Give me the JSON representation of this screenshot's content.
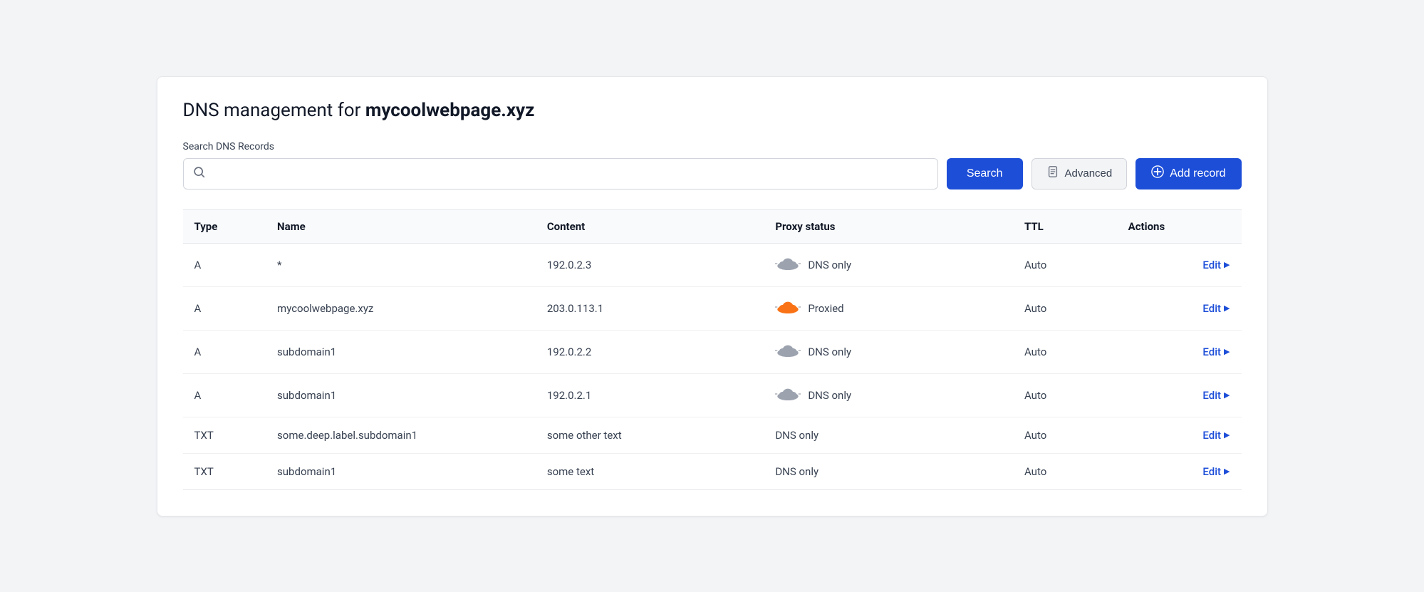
{
  "page": {
    "title_prefix": "DNS management for ",
    "title_domain": "mycoolwebpage.xyz"
  },
  "search": {
    "label": "Search DNS Records",
    "placeholder": "",
    "search_button": "Search",
    "advanced_button": "Advanced",
    "add_record_button": "Add record"
  },
  "table": {
    "columns": [
      "Type",
      "Name",
      "Content",
      "Proxy status",
      "TTL",
      "Actions"
    ],
    "rows": [
      {
        "type": "A",
        "name": "*",
        "content": "192.0.2.3",
        "proxy_status": "DNS only",
        "proxy_type": "dns-only",
        "ttl": "Auto",
        "action": "Edit"
      },
      {
        "type": "A",
        "name": "mycoolwebpage.xyz",
        "content": "203.0.113.1",
        "proxy_status": "Proxied",
        "proxy_type": "proxied",
        "ttl": "Auto",
        "action": "Edit"
      },
      {
        "type": "A",
        "name": "subdomain1",
        "content": "192.0.2.2",
        "proxy_status": "DNS only",
        "proxy_type": "dns-only",
        "ttl": "Auto",
        "action": "Edit"
      },
      {
        "type": "A",
        "name": "subdomain1",
        "content": "192.0.2.1",
        "proxy_status": "DNS only",
        "proxy_type": "dns-only",
        "ttl": "Auto",
        "action": "Edit"
      },
      {
        "type": "TXT",
        "name": "some.deep.label.subdomain1",
        "content": "some other text",
        "proxy_status": "DNS only",
        "proxy_type": "txt",
        "ttl": "Auto",
        "action": "Edit"
      },
      {
        "type": "TXT",
        "name": "subdomain1",
        "content": "some text",
        "proxy_status": "DNS only",
        "proxy_type": "txt",
        "ttl": "Auto",
        "action": "Edit"
      }
    ]
  },
  "colors": {
    "primary": "#1d4ed8",
    "cloud_orange": "#f97316",
    "cloud_gray": "#9ca3af",
    "text_primary": "#111827",
    "text_secondary": "#374151"
  }
}
